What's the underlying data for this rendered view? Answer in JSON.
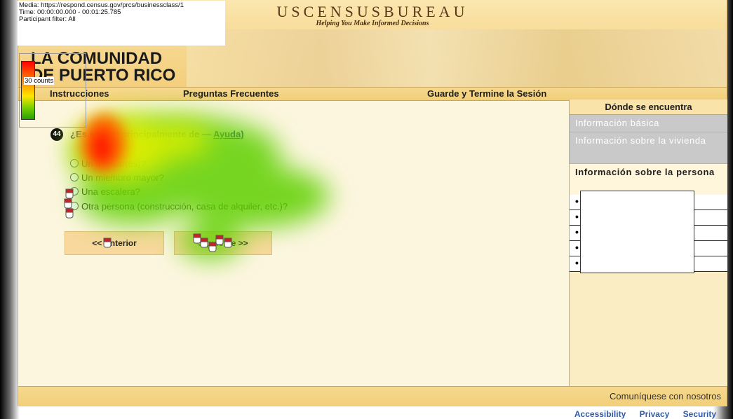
{
  "media_info": {
    "line1": "Media: https://respond.census.gov/prcs/businessclass/1",
    "line2": "Time: 00:00:00.000 - 00:01:25.785",
    "line3": "Participant filter: All"
  },
  "legend": {
    "label": "30 counts"
  },
  "header": {
    "brand_title": "USCENSUSBUREAU",
    "brand_sub": "Helping You Make Informed Decisions",
    "region_line1": "LA COMUNIDAD",
    "region_line2": "DE PUERTO RICO"
  },
  "nav": {
    "instructions": "Instrucciones",
    "faq": "Preguntas Frecuentes",
    "save_exit": "Guarde y Termine la Sesión"
  },
  "question": {
    "number": "44",
    "text": "¿Es ésta(s) principalmente de —",
    "help": "Ayuda)",
    "options": [
      "Un familiar(es)?",
      "Un miembro mayor?",
      "Una escalera?",
      "Otra persona (construcción, casa de alquiler, etc.)?"
    ]
  },
  "buttons": {
    "previous": "<<  Anterior",
    "next": "Siguiente  >>"
  },
  "sidebar": {
    "heading": "Dónde se encuentra",
    "items": [
      {
        "label": "Información básica",
        "state": "done"
      },
      {
        "label": "Información sobre la vivienda",
        "state": "done"
      },
      {
        "label": "Información sobre la persona",
        "state": "current"
      }
    ],
    "bullets": [
      "•",
      "•",
      "•",
      "•",
      "•"
    ]
  },
  "footer": {
    "contact": "Comuníquese con nosotros",
    "links": [
      "Accessibility",
      "Privacy",
      "Security"
    ]
  },
  "colors": {
    "page_bg": "#fdf6df",
    "header_gold": "#f3cf7d",
    "link_blue": "#2f5ba8"
  }
}
